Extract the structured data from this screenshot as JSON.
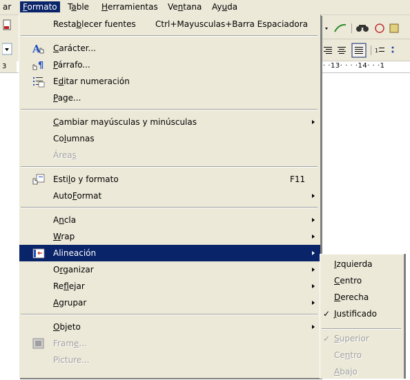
{
  "menubar": {
    "items": [
      {
        "label": "ar",
        "active": false
      },
      {
        "label": "Formato",
        "active": true
      },
      {
        "label": "Table",
        "active": false
      },
      {
        "label": "Herramientas",
        "active": false
      },
      {
        "label": "Ventana",
        "active": false
      },
      {
        "label": "Ayuda",
        "active": false
      }
    ]
  },
  "ruler": {
    "left_value": "3",
    "marks": "· ·13· · · ·14· · ·1"
  },
  "format_menu": {
    "items": [
      {
        "label": "Restablecer fuentes",
        "shortcut": "Ctrl+Mayusculas+Barra Espaciadora"
      },
      {
        "label": "Carácter...",
        "icon": "character-icon"
      },
      {
        "label": "Párrafo...",
        "icon": "paragraph-icon"
      },
      {
        "label": "Editar numeración",
        "icon": "numbering-icon"
      },
      {
        "label": "Page..."
      },
      {
        "label": "Cambiar mayúsculas y minúsculas",
        "submenu": true
      },
      {
        "label": "Columnas"
      },
      {
        "label": "Áreas",
        "disabled": true
      },
      {
        "label": "Estilo y formato",
        "shortcut": "F11",
        "icon": "styles-icon"
      },
      {
        "label": "AutoFormat",
        "submenu": true
      },
      {
        "label": "Ancla",
        "submenu": true
      },
      {
        "label": "Wrap",
        "submenu": true
      },
      {
        "label": "Alineación",
        "submenu": true,
        "highlighted": true,
        "icon": "alignment-icon"
      },
      {
        "label": "Organizar",
        "submenu": true
      },
      {
        "label": "Reflejar",
        "submenu": true
      },
      {
        "label": "Agrupar",
        "submenu": true
      },
      {
        "label": "Objeto",
        "submenu": true
      },
      {
        "label": "Frame...",
        "disabled": true,
        "icon": "frame-icon"
      },
      {
        "label": "Picture...",
        "disabled": true
      }
    ]
  },
  "alignment_submenu": {
    "items": [
      {
        "label": "Izquierda",
        "checked": false,
        "disabled": false
      },
      {
        "label": "Centro",
        "checked": false,
        "disabled": false
      },
      {
        "label": "Derecha",
        "checked": false,
        "disabled": false
      },
      {
        "label": "Justificado",
        "checked": true,
        "disabled": false
      },
      {
        "label": "Superior",
        "checked": true,
        "disabled": true
      },
      {
        "label": "Centro",
        "checked": false,
        "disabled": true
      },
      {
        "label": "Abajo",
        "checked": false,
        "disabled": true
      }
    ]
  },
  "colors": {
    "highlight": "#0a246a",
    "menu_bg": "#ece9d8",
    "disabled_text": "#a0a0a0"
  }
}
